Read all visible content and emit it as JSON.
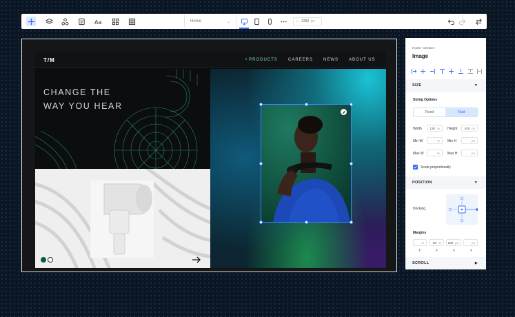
{
  "toolbar": {
    "page_select": "Home",
    "width_value": "1280",
    "width_unit": "px"
  },
  "site": {
    "logo": "T/M",
    "nav": [
      "PRODUCTS",
      "CAREERS",
      "NEWS",
      "ABOUT US"
    ],
    "headline_line1": "CHANGE THE",
    "headline_line2": "WAY YOU HEAR"
  },
  "inspector": {
    "breadcrumb": [
      "Home",
      "Section"
    ],
    "title": "Image",
    "sections": {
      "size": "SIZE",
      "position": "POSITION",
      "scroll": "SCROLL"
    },
    "sizing_options_label": "Sizing Options",
    "sizing_fixed": "Fixed",
    "sizing_fluid": "Fluid",
    "width_label": "Width",
    "width_value": "120",
    "width_unit": "%",
    "height_label": "Height",
    "height_value": "420",
    "height_unit": "px",
    "min_w_label": "Min W",
    "min_w_unit": "%",
    "min_h_label": "Min H",
    "min_h_unit": "px",
    "max_w_label": "Max W",
    "max_w_unit": "%",
    "max_h_label": "Max H",
    "max_h_unit": "px",
    "scale_label": "Scale proportionally",
    "docking_label": "Docking",
    "margins_label": "Margins",
    "margins": [
      {
        "value": "",
        "unit": "%"
      },
      {
        "value": "50",
        "unit": "%"
      },
      {
        "value": "200",
        "unit": "px"
      },
      {
        "value": "",
        "unit": "px"
      }
    ]
  },
  "colors": {
    "accent": "#2f6df6",
    "nav_active": "#7be0bf",
    "canvas_bg": "#0b1624"
  }
}
